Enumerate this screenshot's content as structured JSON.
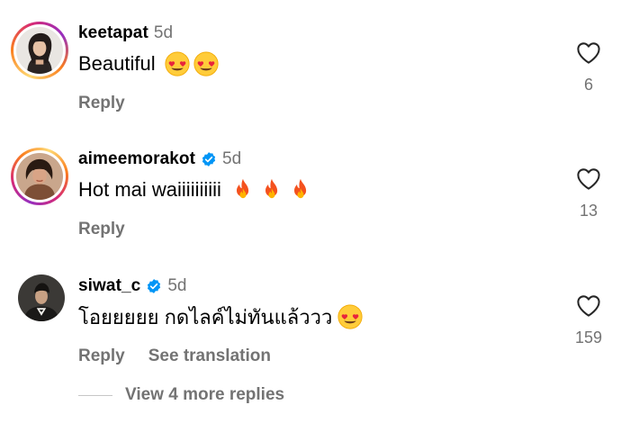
{
  "comments": [
    {
      "username": "keetapat",
      "verified": false,
      "age": "5d",
      "text": "Beautiful",
      "emoji": [
        "heart-eyes-emoji",
        "heart-eyes-emoji"
      ],
      "reply_label": "Reply",
      "likes": "6"
    },
    {
      "username": "aimeemorakot",
      "verified": true,
      "age": "5d",
      "text": "Hot mai waiiiiiiiiii",
      "emoji": [
        "fire-emoji",
        "fire-emoji",
        "fire-emoji"
      ],
      "reply_label": "Reply",
      "likes": "13"
    },
    {
      "username": "siwat_c",
      "verified": true,
      "age": "5d",
      "text": "โอยยยยย กดไลค์ไม่ทันแล้ววว",
      "emoji": [
        "heart-eyes-emoji"
      ],
      "reply_label": "Reply",
      "translate_label": "See translation",
      "likes": "159"
    }
  ],
  "more_replies_label": "View 4 more replies",
  "icons": {
    "like": "heart-outline-icon",
    "verified": "verified-badge-icon"
  },
  "colors": {
    "primary_text": "#000000",
    "secondary_text": "#737373",
    "verified_blue": "#0095f6",
    "divider": "#c7c7c7"
  }
}
